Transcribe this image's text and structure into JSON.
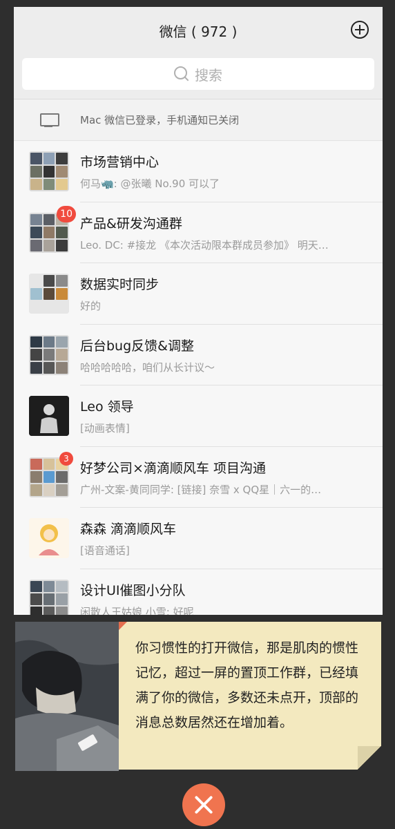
{
  "header": {
    "title": "微信 ( 972 )",
    "add_icon": "plus-circle-icon"
  },
  "search": {
    "placeholder": "搜索",
    "icon": "search-icon"
  },
  "login_notice": {
    "icon": "monitor-icon",
    "text": "Mac 微信已登录，手机通知已关闭"
  },
  "chats": [
    {
      "name": "市场营销中心",
      "message": "何马🦏: @张曦 No.90 可以了",
      "badge": ""
    },
    {
      "name": "产品&研发沟通群",
      "message": "Leo.  DC: #接龙 《本次活动限本群成员参加》 明天…",
      "badge": "10"
    },
    {
      "name": "数据实时同步",
      "message": "好的",
      "badge": ""
    },
    {
      "name": "后台bug反馈&调整",
      "message": "哈哈哈哈哈，咱们从长计议～",
      "badge": ""
    },
    {
      "name": "Leo 领导",
      "message": "[动画表情]",
      "badge": ""
    },
    {
      "name": "好梦公司×滴滴顺风车 项目沟通",
      "message": "广州-文案-黄同同学: [链接] 奈雪 x QQ星｜六一的…",
      "badge": "3"
    },
    {
      "name": "森森 滴滴顺风车",
      "message": "[语音通话]",
      "badge": ""
    },
    {
      "name": "设计UI催图小分队",
      "message": "闲散人王姑娘 小雪: 好呢",
      "badge": ""
    }
  ],
  "caption": {
    "text": "你习惯性的打开微信，那是肌肉的惯性记忆，超过一屏的置顶工作群，已经填满了你的微信，多数还未点开，顶部的消息总数居然还在增加着。"
  },
  "close_icon": "close-icon",
  "colors": {
    "badge": "#f04b3e",
    "note_bg": "#f3e9bf",
    "close_button": "#f0744f"
  }
}
